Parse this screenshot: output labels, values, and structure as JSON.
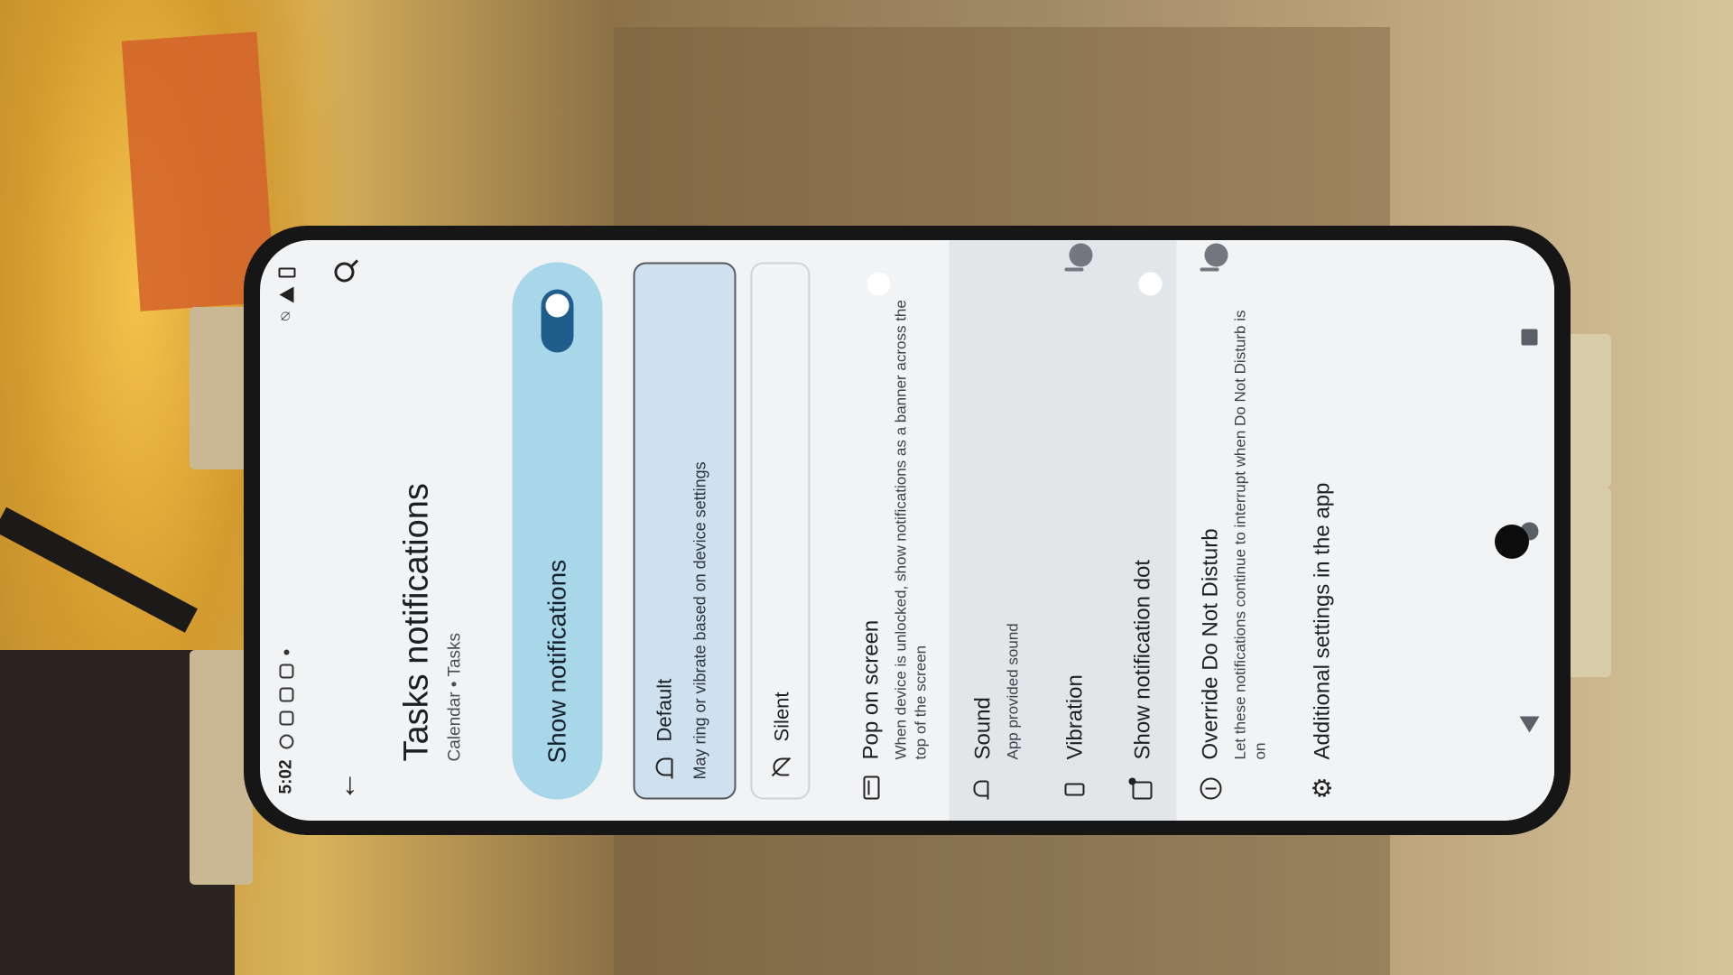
{
  "status_bar": {
    "time": "5:02"
  },
  "header": {
    "title": "Tasks notifications",
    "subtitle": "Calendar • Tasks",
    "back_icon": "arrow-left-icon",
    "search_icon": "search-icon"
  },
  "master_toggle": {
    "label": "Show notifications",
    "on": true
  },
  "alert_options": [
    {
      "label": "Default",
      "description": "May ring or vibrate based on device settings",
      "selected": true,
      "icon": "bell-icon"
    },
    {
      "label": "Silent",
      "description": "",
      "selected": false,
      "icon": "bell-off-icon"
    }
  ],
  "settings": [
    {
      "title": "Pop on screen",
      "description": "When device is unlocked, show notifications as a banner across the top of the screen",
      "toggle": "on",
      "icon": "popup-icon"
    },
    {
      "title": "Sound",
      "description": "App provided sound",
      "toggle": "none",
      "icon": "bell-icon"
    },
    {
      "title": "Vibration",
      "description": "",
      "toggle": "off",
      "icon": "vibration-icon"
    },
    {
      "title": "Show notification dot",
      "description": "",
      "toggle": "on",
      "icon": "notification-dot-icon"
    },
    {
      "title": "Override Do Not Disturb",
      "description": "Let these notifications continue to interrupt when Do Not Disturb is on",
      "toggle": "off",
      "icon": "do-not-disturb-icon"
    },
    {
      "title": "Additional settings in the app",
      "description": "",
      "toggle": "none",
      "icon": "gear-icon"
    }
  ],
  "colors": {
    "accent": "#1f5d8c",
    "master_bg": "#a9d7ea",
    "selected_option_bg": "#cfe0ee"
  }
}
